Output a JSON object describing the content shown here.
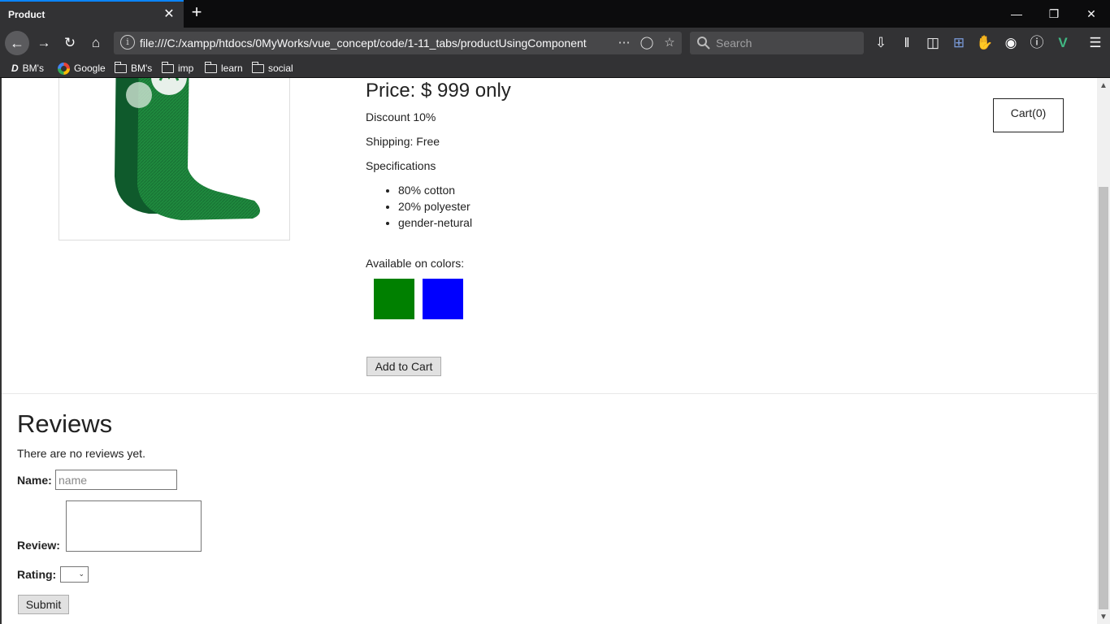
{
  "browser": {
    "tab_title": "Product",
    "tab_close": "✕",
    "new_tab": "+",
    "url": "file:///C:/xampp/htdocs/0MyWorks/vue_concept/code/1-11_tabs/productUsingComponent",
    "search_placeholder": "Search",
    "bookmarks": [
      "BM's",
      "Google",
      "BM's",
      "imp",
      "learn",
      "social"
    ]
  },
  "product": {
    "price": "Price: $ 999 only",
    "discount": "Discount 10%",
    "shipping": "Shipping: Free",
    "specs_title": "Specifications",
    "specs": [
      "80% cotton",
      "20% polyester",
      "gender-netural"
    ],
    "colors_label": "Available on colors:",
    "colors": [
      "#008000",
      "#0000ff"
    ],
    "add_to_cart": "Add to Cart",
    "cart": "Cart(0)"
  },
  "reviews": {
    "title": "Reviews",
    "empty_text": "There are no reviews yet.",
    "name_label": "Name:",
    "name_placeholder": "name",
    "review_label": "Review:",
    "rating_label": "Rating:",
    "submit": "Submit"
  }
}
